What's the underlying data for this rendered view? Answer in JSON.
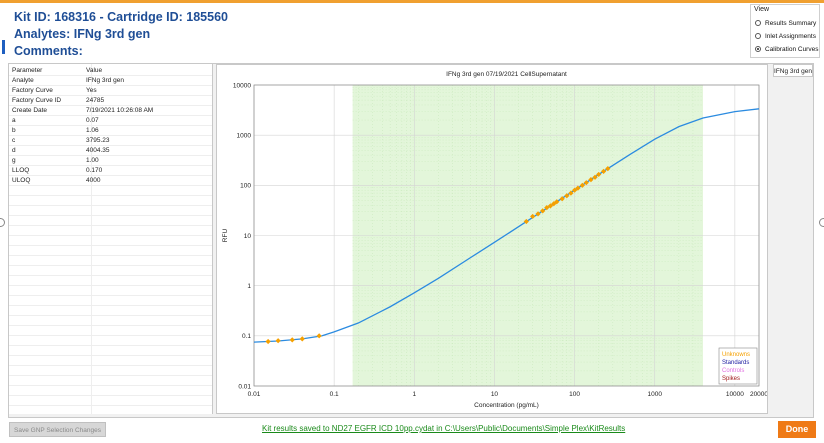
{
  "header": {
    "kit_line": "Kit ID: 168316 - Cartridge ID: 185560",
    "analytes_line": "Analytes:  IFNg 3rd gen",
    "comments_line": "Comments:"
  },
  "view": {
    "title": "View",
    "options": [
      {
        "label": "Results Summary",
        "selected": false
      },
      {
        "label": "Inlet Assignments",
        "selected": false
      },
      {
        "label": "Calibration Curves",
        "selected": true
      }
    ]
  },
  "table": {
    "columns": [
      "Parameter",
      "Value"
    ],
    "rows": [
      [
        "Analyte",
        "IFNg 3rd gen"
      ],
      [
        "Factory Curve",
        "Yes"
      ],
      [
        "Factory Curve ID",
        "24785"
      ],
      [
        "Create Date",
        "7/19/2021 10:26:08 AM"
      ],
      [
        "a",
        "0.07"
      ],
      [
        "b",
        "1.06"
      ],
      [
        "c",
        "3795.23"
      ],
      [
        "d",
        "4004.35"
      ],
      [
        "g",
        "1.00"
      ],
      [
        "LLOQ",
        "0.170"
      ],
      [
        "ULOQ",
        "4000"
      ]
    ]
  },
  "tab_label": "IFNg 3rd gen",
  "colors": {
    "header_blue": "#1f4e96",
    "curve": "#2b8be0",
    "unknown_marker": "#f5a000",
    "range_fill": "#e3f6da",
    "done_orange": "#ef7a16",
    "status_green": "#1a8a1a"
  },
  "chart_data": {
    "type": "line",
    "title": "IFNg 3rd gen   07/19/2021   CellSupernatant",
    "xlabel": "Concentration (pg/mL)",
    "ylabel": "RFU",
    "x_scale": "log",
    "y_scale": "log",
    "xlim": [
      0.01,
      20000
    ],
    "ylim": [
      0.01,
      10000
    ],
    "x_ticks": [
      0.01,
      0.1,
      1,
      10,
      100,
      1000,
      10000,
      20000
    ],
    "x_tick_labels": [
      "0.01",
      "0.1",
      "1",
      "10",
      "100",
      "1000",
      "10000",
      "20000"
    ],
    "y_ticks": [
      0.01,
      0.1,
      1,
      10,
      100,
      1000,
      10000
    ],
    "y_tick_labels": [
      "0.01",
      "0.1",
      "1",
      "10",
      "100",
      "1000",
      "10000"
    ],
    "shaded_range": {
      "x_start": 0.17,
      "x_end": 4000
    },
    "curve": {
      "x": [
        0.01,
        0.02,
        0.04,
        0.07,
        0.1,
        0.2,
        0.5,
        1,
        2,
        5,
        10,
        20,
        50,
        100,
        200,
        500,
        1000,
        2000,
        4000,
        10000,
        20000
      ],
      "y": [
        0.075,
        0.079,
        0.087,
        0.1,
        0.12,
        0.18,
        0.38,
        0.72,
        1.4,
        3.6,
        7.3,
        15,
        39,
        80,
        165,
        420,
        830,
        1480,
        2200,
        2950,
        3350
      ]
    },
    "unknown_points": {
      "x": [
        0.015,
        0.02,
        0.03,
        0.04,
        0.065,
        25,
        30,
        35,
        40,
        45,
        50,
        55,
        60,
        70,
        80,
        90,
        100,
        110,
        125,
        140,
        160,
        180,
        200,
        230,
        260
      ],
      "y": [
        0.077,
        0.08,
        0.083,
        0.087,
        0.1,
        19,
        24,
        27,
        31,
        36,
        39,
        43,
        47,
        54,
        62,
        70,
        80,
        88,
        100,
        113,
        130,
        145,
        165,
        190,
        215
      ]
    },
    "legend": {
      "placement": "bottom-right",
      "entries": [
        {
          "label": "Unknowns",
          "color": "#f5a000"
        },
        {
          "label": "Standards",
          "color": "#1a1aa0"
        },
        {
          "label": "Controls",
          "color": "#e070e0"
        },
        {
          "label": "Spikes",
          "color": "#a01a1a"
        }
      ]
    },
    "grid": true
  },
  "footer": {
    "save_gnp_label": "Save GNP Selection Changes",
    "status_text": "Kit results saved to ND27 EGFR ICD 10pp.cydat in C:\\Users\\Public\\Documents\\Simple Plex\\KitResults",
    "done_label": "Done"
  }
}
